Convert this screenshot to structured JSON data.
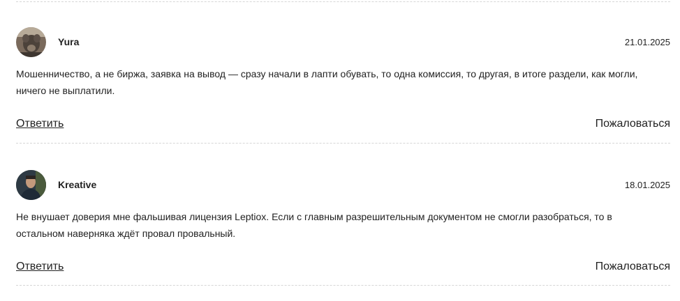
{
  "comments": [
    {
      "author": "Yura",
      "avatar_icon": "user-photo-icon",
      "date": "21.01.2025",
      "text": "Мошенничество, а не биржа, заявка на вывод — сразу начали в лапти обувать, то одна комиссия, то другая, в итоге раздели, как могли, ничего не выплатили.",
      "reply_label": "Ответить",
      "report_label": "Пожаловаться"
    },
    {
      "author": "Kreative",
      "avatar_icon": "user-photo-icon",
      "date": "18.01.2025",
      "text": "Не внушает доверия мне фальшивая лицензия Leptiox. Если с главным разрешительным документом не смогли разобраться, то в остальном наверняка ждёт провал провальный.",
      "reply_label": "Ответить",
      "report_label": "Пожаловаться"
    }
  ],
  "colors": {
    "text": "#222222",
    "divider": "#d6d6d6",
    "background": "#ffffff"
  }
}
